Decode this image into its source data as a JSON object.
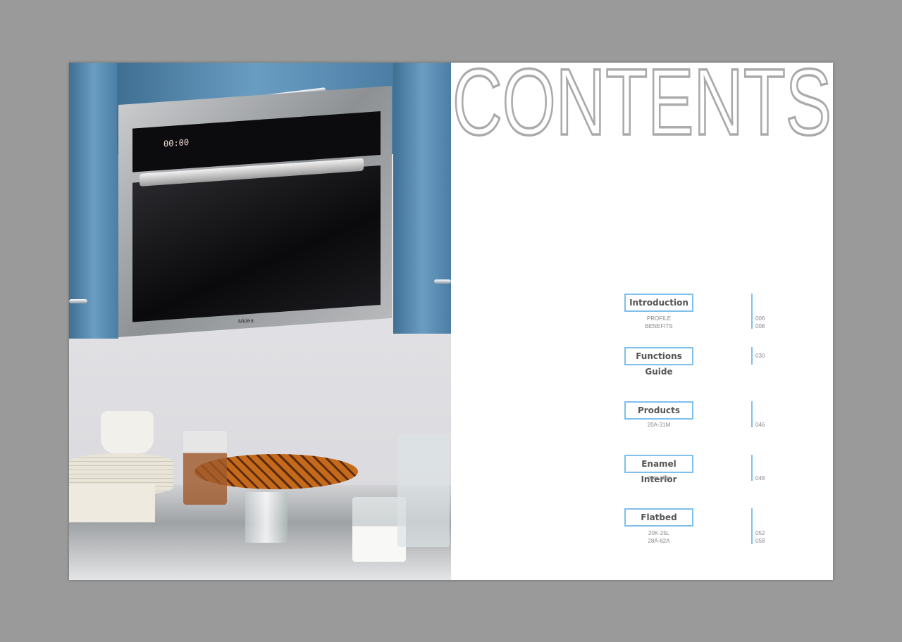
{
  "title": "CONTENTS",
  "accent_color": "#7fc0ec",
  "photo": {
    "brand": "Midea",
    "display": "00:00"
  },
  "entries": [
    {
      "label": "Introduction",
      "subs": [
        "PROFILE",
        "BENEFITS"
      ],
      "pages": [
        "006",
        "008"
      ]
    },
    {
      "label": "Functions Guide",
      "subs": [],
      "pages": [
        "030"
      ]
    },
    {
      "label": "Products",
      "subs": [
        "20A-31M"
      ],
      "pages": [
        "046"
      ]
    },
    {
      "label": "Enamel Interior",
      "subs": [
        "20N-25N"
      ],
      "pages": [
        "048"
      ]
    },
    {
      "label": "Flatbed",
      "subs": [
        "20K-25L",
        "28A-62A"
      ],
      "pages": [
        "052",
        "058"
      ]
    }
  ]
}
